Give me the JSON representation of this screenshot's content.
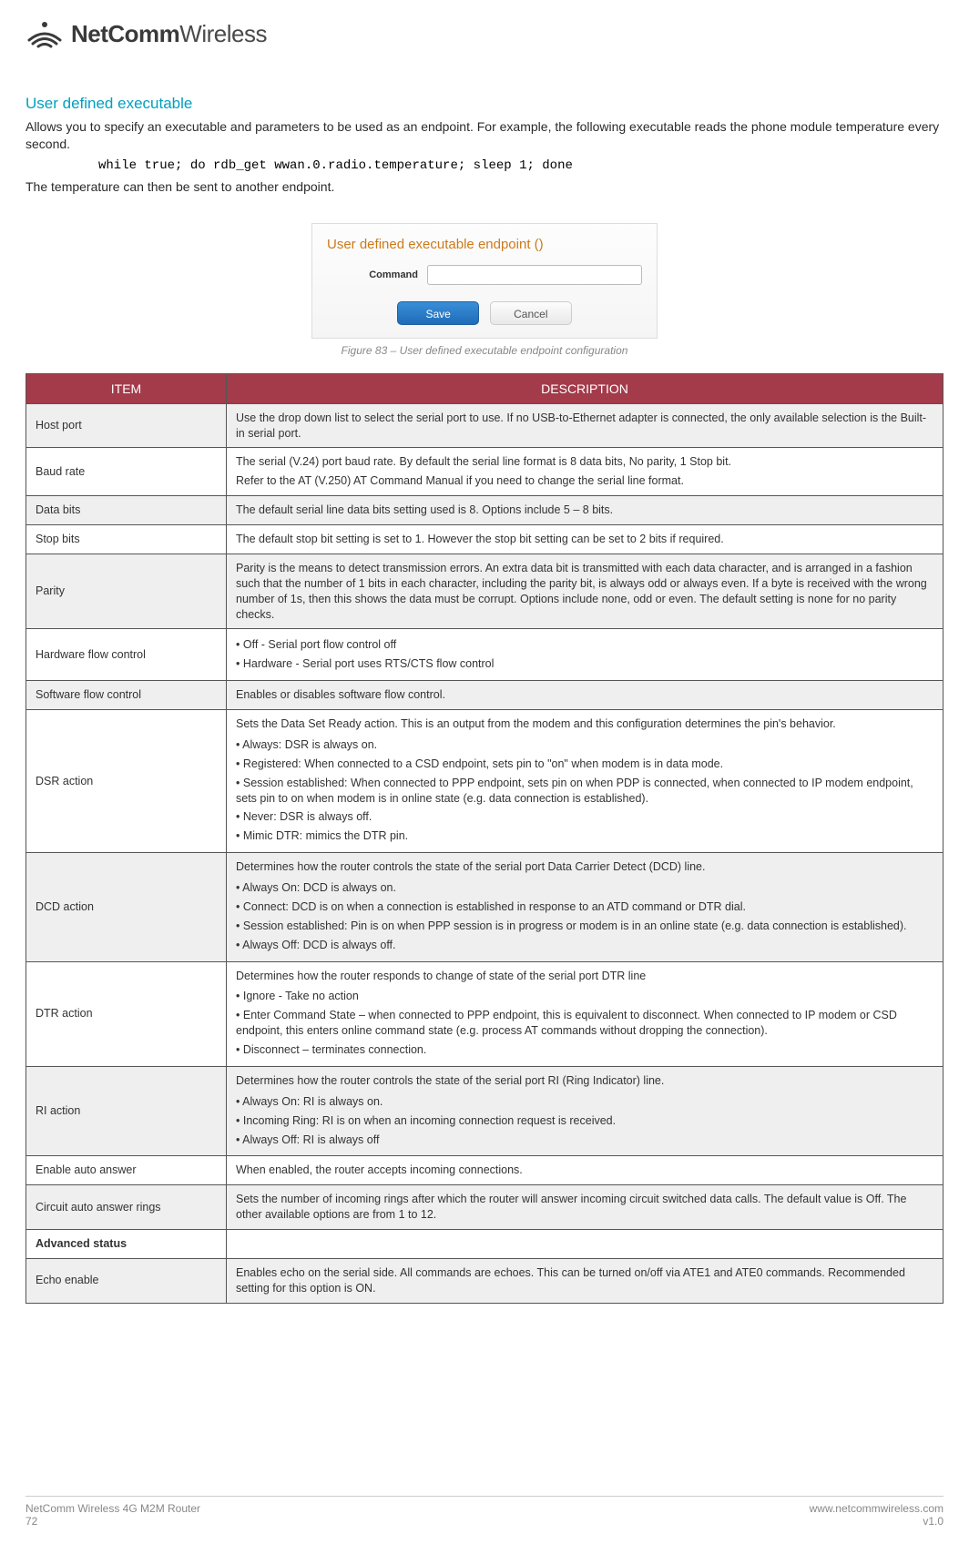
{
  "logo": {
    "bold": "NetComm",
    "light": "Wireless"
  },
  "section_title": "User defined executable",
  "intro_p1": "Allows you to specify an executable and parameters to be used as an endpoint. For example, the following executable reads the phone module temperature every second.",
  "code": "while true; do rdb_get wwan.0.radio.temperature; sleep 1; done",
  "intro_p2": "The temperature can then be sent to another endpoint.",
  "dialog": {
    "title": "User defined executable endpoint ()",
    "field_label": "Command",
    "save": "Save",
    "cancel": "Cancel"
  },
  "figure_caption": "Figure 83 – User defined executable endpoint configuration",
  "table": {
    "headers": [
      "ITEM",
      "DESCRIPTION"
    ],
    "rows": {
      "host_port": {
        "item": "Host port",
        "desc": "Use the drop down list to select the serial port to use. If no USB-to-Ethernet adapter is connected, the only available selection is the Built-in serial port."
      },
      "baud_rate": {
        "item": "Baud rate",
        "desc1": "The serial (V.24) port baud rate. By default the serial line format is 8 data bits, No parity, 1 Stop bit.",
        "desc2": "Refer to the AT (V.250) AT Command Manual if you need to change the serial line format."
      },
      "data_bits": {
        "item": "Data bits",
        "desc": "The default serial line data bits setting used is 8. Options include 5 – 8 bits."
      },
      "stop_bits": {
        "item": "Stop bits",
        "desc": "The default stop bit setting is set to 1. However the stop bit setting can be set to 2 bits if required."
      },
      "parity": {
        "item": "Parity",
        "desc": "Parity is the means to detect transmission errors. An extra data bit is transmitted with each data character, and is arranged in a fashion such that the number of 1 bits in each character, including the parity bit, is always odd or always even. If a byte is received with the wrong number of 1s, then this shows the data must be corrupt. Options include none, odd or even. The default setting is none for no parity checks."
      },
      "hw_flow": {
        "item": "Hardware flow control",
        "b1": "Off  - Serial port flow control off",
        "b2": "Hardware - Serial port uses RTS/CTS flow control"
      },
      "sw_flow": {
        "item": "Software flow control",
        "desc": "Enables or disables software flow control."
      },
      "dsr": {
        "item": "DSR action",
        "intro": "Sets the Data Set Ready action. This is an output from the modem and this configuration determines the pin's behavior.",
        "b1": "Always: DSR is always on.",
        "b2": "Registered: When connected to a CSD endpoint, sets pin to \"on\" when modem is in data mode.",
        "b3": "Session established: When connected to PPP endpoint, sets pin on when PDP is connected, when connected to IP modem endpoint, sets pin to on when modem is in online state (e.g. data connection is established).",
        "b4": "Never: DSR is always off.",
        "b5": "Mimic DTR: mimics the DTR pin."
      },
      "dcd": {
        "item": "DCD action",
        "intro": "Determines how the router controls the state of the serial port Data Carrier Detect (DCD) line.",
        "b1": "Always On: DCD is always on.",
        "b2": "Connect: DCD is on when a connection is established in response to an ATD command or DTR dial.",
        "b3": "Session established: Pin is on when PPP session is in progress or modem is in an online state (e.g. data connection is established).",
        "b4": "Always Off: DCD is always off."
      },
      "dtr": {
        "item": "DTR action",
        "intro": "Determines how the router responds to change of state of the serial port DTR line",
        "b1": "Ignore - Take no action",
        "b2": "Enter Command State – when connected to PPP endpoint, this is equivalent to disconnect. When connected to IP modem or CSD endpoint, this enters online command state (e.g. process AT commands without dropping the connection).",
        "b3": "Disconnect – terminates connection."
      },
      "ri": {
        "item": "RI action",
        "intro": "Determines how the router controls the state of the serial port RI (Ring Indicator) line.",
        "b1": "Always On: RI is always on.",
        "b2": "Incoming Ring: RI is on when an incoming connection request is received.",
        "b3": "Always Off: RI is always off"
      },
      "auto_answer": {
        "item": "Enable auto answer",
        "desc": "When enabled, the router accepts incoming connections."
      },
      "circuit_rings": {
        "item": "Circuit auto answer rings",
        "desc": "Sets the number of incoming rings after which the router will answer incoming circuit switched data calls. The default value is Off. The other available options are from 1 to 12."
      },
      "adv_status": {
        "item": "Advanced status"
      },
      "echo": {
        "item": "Echo enable",
        "desc": "Enables echo on the serial side. All commands are echoes. This can be turned on/off via ATE1 and ATE0 commands. Recommended setting for this option is ON."
      }
    }
  },
  "footer": {
    "left1": "NetComm Wireless 4G M2M Router",
    "left2": "72",
    "right1": "www.netcommwireless.com",
    "right2": "v1.0"
  }
}
